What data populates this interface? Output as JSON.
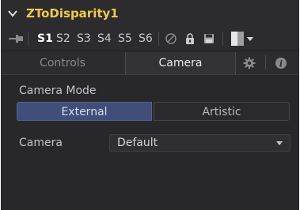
{
  "header": {
    "title": "ZToDisparity1",
    "chevron_icon": "chevron-down-icon",
    "title_color": "#f3c94a"
  },
  "toolbar": {
    "pin_icon": "pin-icon",
    "slots": [
      "S1",
      "S2",
      "S3",
      "S4",
      "S5",
      "S6"
    ],
    "active_slot": "S1",
    "icons": [
      "disable-icon",
      "lock-icon",
      "save-icon"
    ],
    "color_swatch_icon": "color-swatch",
    "swatch_menu_icon": "chevron-down-icon"
  },
  "tabs": {
    "items": [
      {
        "label": "Controls",
        "active": false
      },
      {
        "label": "Camera",
        "active": true
      }
    ],
    "settings_icon": "gear-icon",
    "info_icon": "info-icon"
  },
  "camera_tab": {
    "mode_label": "Camera Mode",
    "mode_options": [
      "External",
      "Artistic"
    ],
    "mode_selected": "External",
    "camera_label": "Camera",
    "camera_value": "Default",
    "accent_color": "#3f4f7a"
  }
}
